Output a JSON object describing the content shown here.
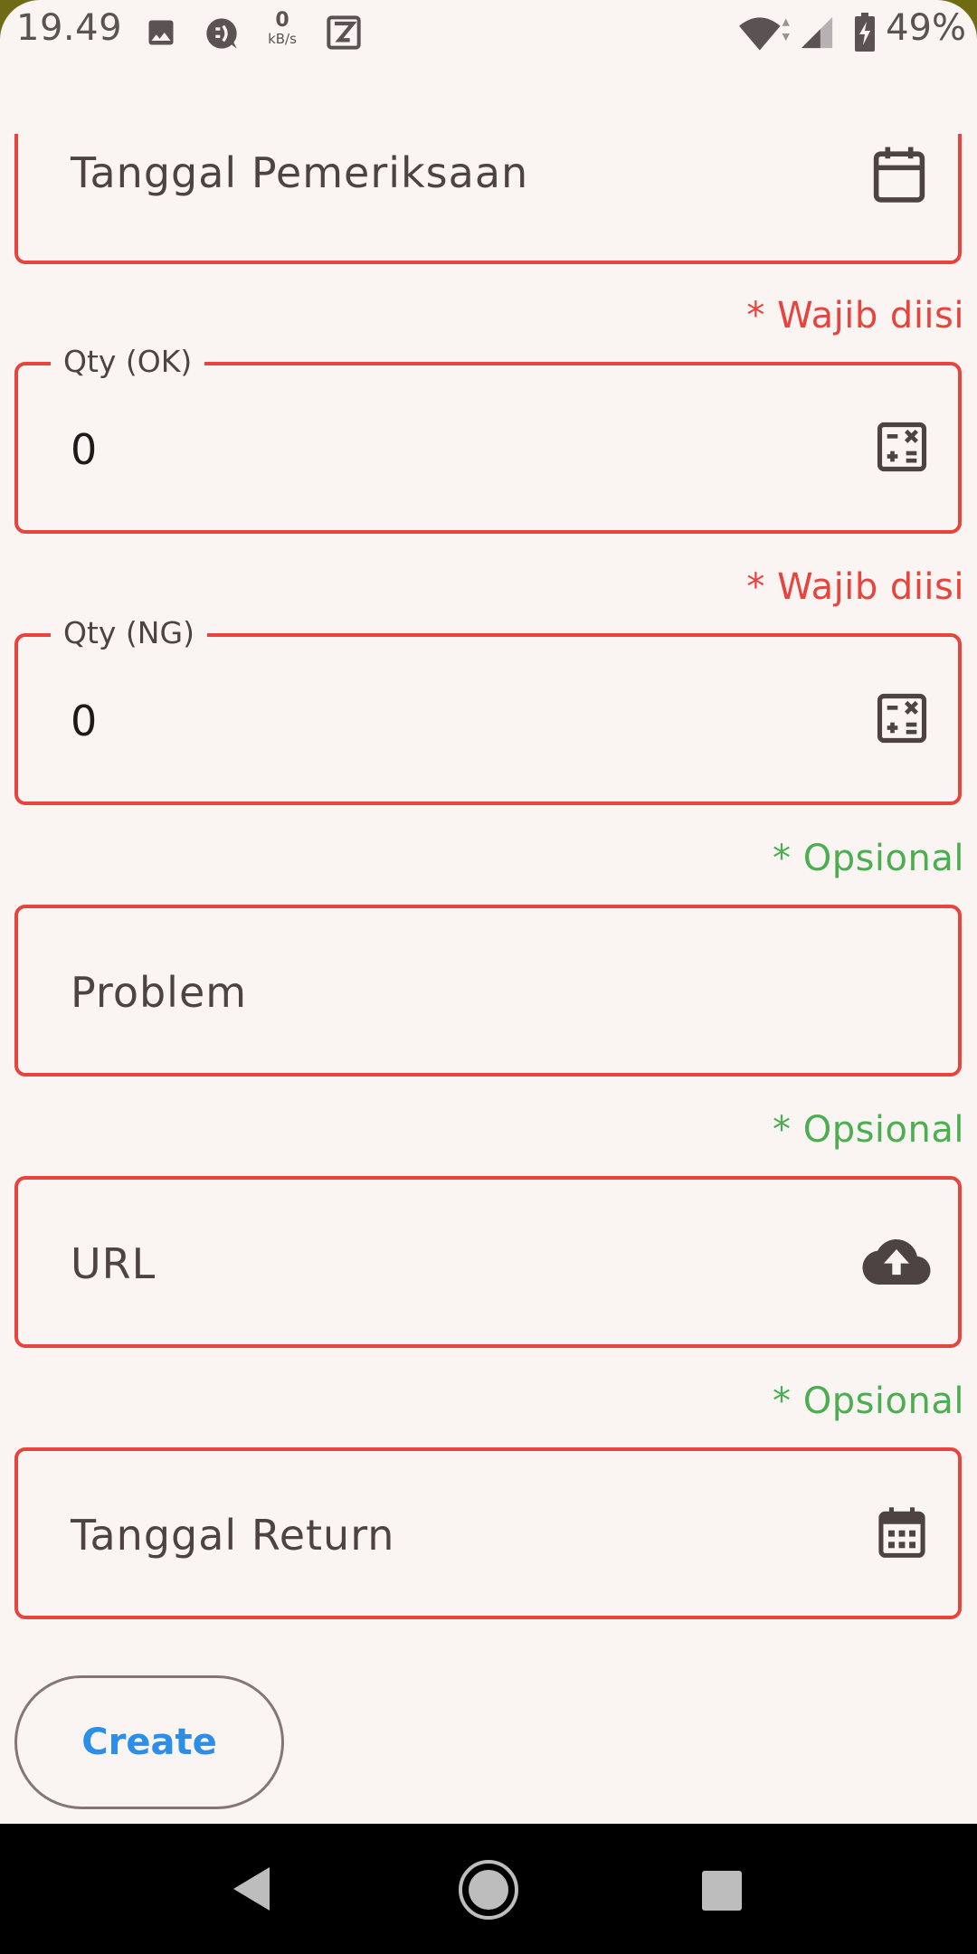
{
  "status_bar": {
    "time": "19.49",
    "net_speed_value": "0",
    "net_speed_unit": "kB/s",
    "battery": "49%",
    "icons": [
      "image-icon",
      "chat-icon",
      "net-speed-icon",
      "app-k-icon",
      "wifi-icon",
      "signal-icon",
      "battery-icon"
    ]
  },
  "form": {
    "tanggal_pemeriksaan": {
      "placeholder": "Tanggal Pemeriksaan",
      "icon": "calendar-icon"
    },
    "qty_ok": {
      "hint": "* Wajib diisi",
      "label": "Qty (OK)",
      "value": "0",
      "icon": "calculator-icon"
    },
    "qty_ng": {
      "hint": "* Wajib diisi",
      "label": "Qty (NG)",
      "value": "0",
      "icon": "calculator-icon"
    },
    "problem": {
      "hint": "* Opsional",
      "placeholder": "Problem"
    },
    "url": {
      "hint": "* Opsional",
      "placeholder": "URL",
      "icon": "cloud-upload-icon"
    },
    "tanggal_return": {
      "hint": "* Opsional",
      "placeholder": "Tanggal Return",
      "icon": "calendar-grid-icon"
    },
    "create_label": "Create"
  },
  "colors": {
    "error": "#e7443d",
    "optional": "#4bae50",
    "button_text": "#2b8ee8",
    "background": "#faf5f2",
    "wallpaper": "#6f6a14"
  },
  "nav_bar": {
    "icons": [
      "back-icon",
      "home-icon",
      "recents-icon"
    ]
  }
}
